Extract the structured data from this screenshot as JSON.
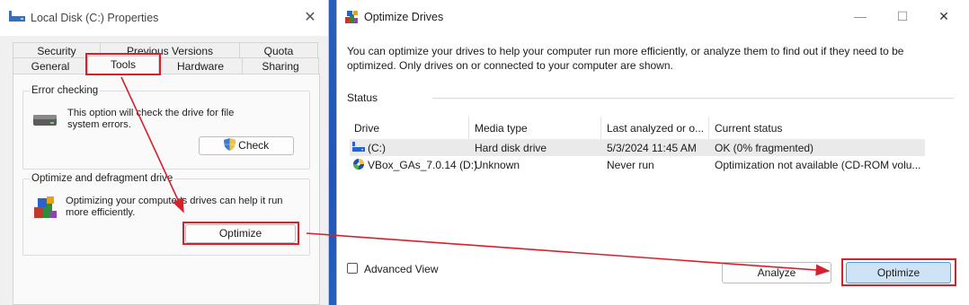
{
  "props_window": {
    "title": "Local Disk (C:) Properties",
    "close_icon": "close-icon",
    "tabs_row1": [
      "Security",
      "Previous Versions",
      "Quota"
    ],
    "tabs_row2": [
      "General",
      "Tools",
      "Hardware",
      "Sharing"
    ],
    "active_tab": "Tools",
    "error_checking": {
      "label": "Error checking",
      "text": "This option will check the drive for file system errors.",
      "button": "Check"
    },
    "optimize_section": {
      "label": "Optimize and defragment drive",
      "text": "Optimizing your computer's drives can help it run more efficiently.",
      "button": "Optimize"
    }
  },
  "optimize_window": {
    "title": "Optimize Drives",
    "description": "You can optimize your drives to help your computer run more efficiently, or analyze them to find out if they need to be optimized. Only drives on or connected to your computer are shown.",
    "status_label": "Status",
    "columns": [
      "Drive",
      "Media type",
      "Last analyzed or o...",
      "Current status"
    ],
    "drives": [
      {
        "drive": "(C:)",
        "media_type": "Hard disk drive",
        "last_analyzed": "5/3/2024 11:45 AM",
        "status": "OK (0% fragmented)",
        "icon": "hard-drive-icon"
      },
      {
        "drive": "VBox_GAs_7.0.14 (D:)",
        "media_type": "Unknown",
        "last_analyzed": "Never run",
        "status": "Optimization not available (CD-ROM volu...",
        "icon": "cd-drive-icon"
      }
    ],
    "advanced_view_label": "Advanced View",
    "advanced_view_checked": false,
    "analyze_button": "Analyze",
    "optimize_button": "Optimize"
  },
  "colors": {
    "annotation_red": "#d8202c",
    "desktop_blue": "#2b63c2",
    "optimize_button_bg": "#cfe3f7"
  }
}
